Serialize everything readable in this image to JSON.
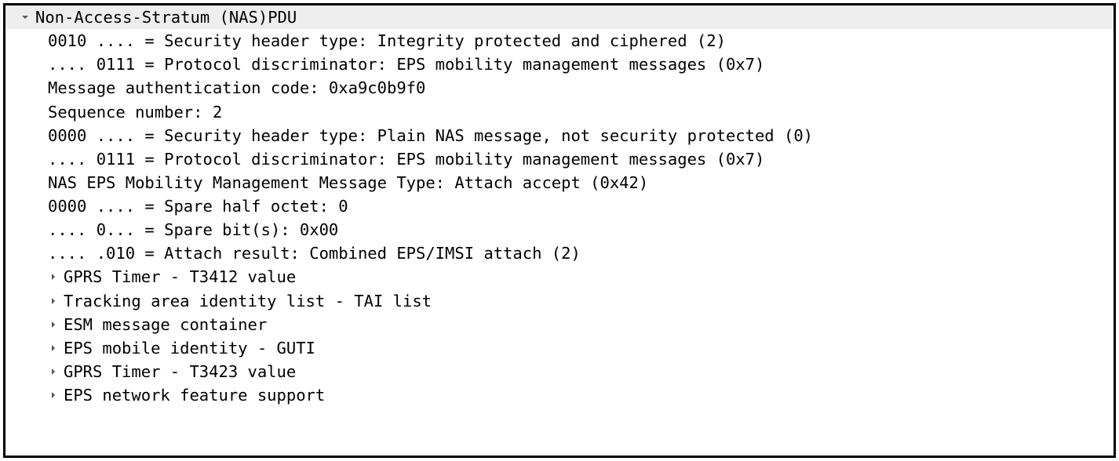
{
  "tree": {
    "root": {
      "label": "Non-Access-Stratum (NAS)PDU"
    },
    "fields": [
      "0010 .... = Security header type: Integrity protected and ciphered (2)",
      ".... 0111 = Protocol discriminator: EPS mobility management messages (0x7)",
      "Message authentication code: 0xa9c0b9f0",
      "Sequence number: 2",
      "0000 .... = Security header type: Plain NAS message, not security protected (0)",
      ".... 0111 = Protocol discriminator: EPS mobility management messages (0x7)",
      "NAS EPS Mobility Management Message Type: Attach accept (0x42)",
      "0000 .... = Spare half octet: 0",
      ".... 0... = Spare bit(s): 0x00",
      ".... .010 = Attach result: Combined EPS/IMSI attach (2)"
    ],
    "subtrees": [
      "GPRS Timer - T3412 value",
      "Tracking area identity list - TAI list",
      "ESM message container",
      "EPS mobile identity - GUTI",
      "GPRS Timer - T3423 value",
      "EPS network feature support"
    ]
  }
}
